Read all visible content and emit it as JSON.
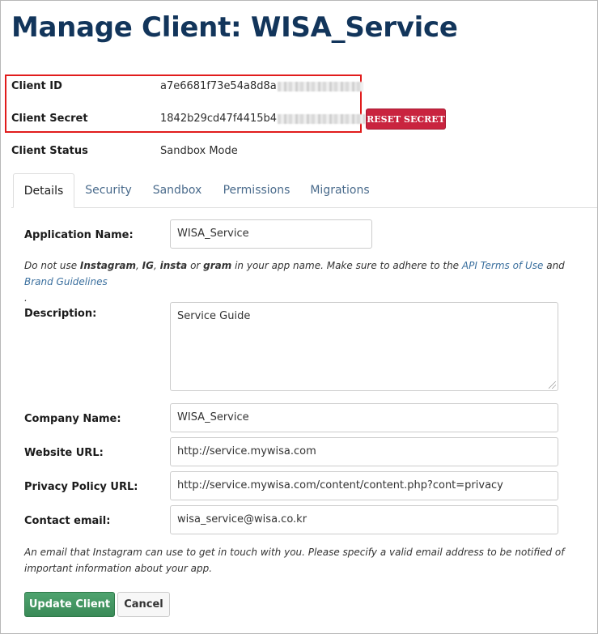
{
  "page": {
    "title": "Manage Client: WISA_Service"
  },
  "client_info": {
    "id_label": "Client ID",
    "id_value": "a7e6681f73e54a8d8a",
    "secret_label": "Client Secret",
    "secret_value": "1842b29cd47f4415b4",
    "status_label": "Client Status",
    "status_value": "Sandbox Mode",
    "reset_button": "RESET SECRET",
    "highlight_color": "#e11c1c"
  },
  "tabs": [
    {
      "label": "Details",
      "active": true
    },
    {
      "label": "Security",
      "active": false
    },
    {
      "label": "Sandbox",
      "active": false
    },
    {
      "label": "Permissions",
      "active": false
    },
    {
      "label": "Migrations",
      "active": false
    }
  ],
  "form": {
    "app_name_label": "Application Name:",
    "app_name_value": "WISA_Service",
    "app_name_help": {
      "prefix": "Do not use ",
      "word1": "Instagram",
      "sep1": ", ",
      "word2": "IG",
      "sep2": ", ",
      "word3": "insta",
      "sep3": " or ",
      "word4": "gram",
      "mid": " in your app name. Make sure to adhere to the ",
      "link1": "API Terms of Use",
      "and": " and ",
      "link2": "Brand Guidelines",
      "end": "."
    },
    "description_label": "Description:",
    "description_value": "Service Guide",
    "company_label": "Company Name:",
    "company_value": "WISA_Service",
    "website_label": "Website URL:",
    "website_value": "http://service.mywisa.com",
    "privacy_label": "Privacy Policy URL:",
    "privacy_value": "http://service.mywisa.com/content/content.php?cont=privacy",
    "email_label": "Contact email:",
    "email_value": "wisa_service@wisa.co.kr",
    "email_help": "An email that Instagram can use to get in touch with you. Please specify a valid email address to be notified of important information about your app.",
    "update_button": "Update Client",
    "cancel_button": "Cancel"
  },
  "colors": {
    "title": "#12355b",
    "reset_button": "#c9243f",
    "update_button": "#3a8a57",
    "link": "#3a6f9e"
  }
}
